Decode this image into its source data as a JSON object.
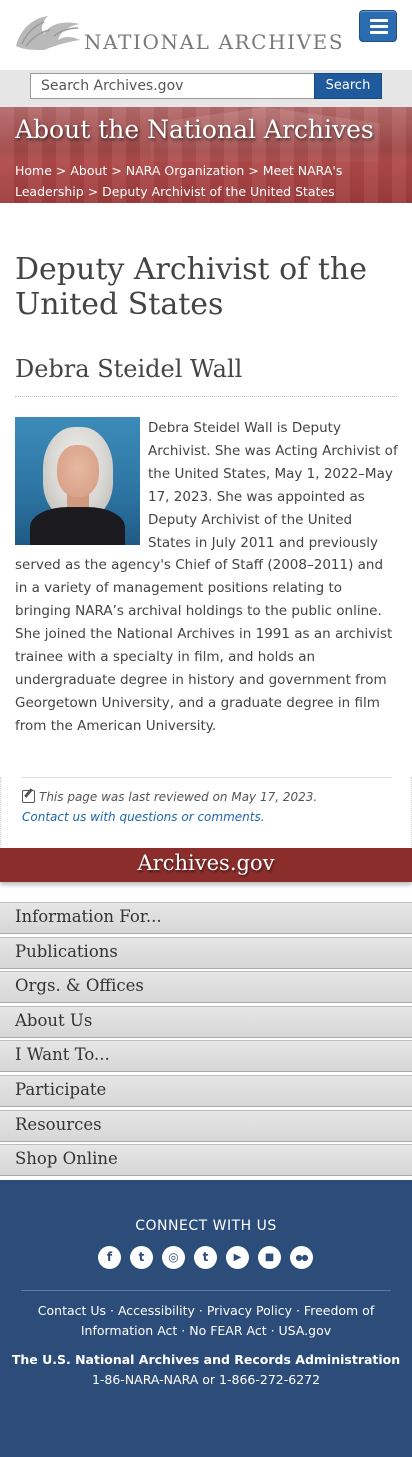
{
  "header": {
    "logo_text": "NATIONAL ARCHIVES",
    "logo_icon": "eagle-logo-icon",
    "menu_icon": "hamburger-menu-icon"
  },
  "search": {
    "placeholder": "Search Archives.gov",
    "button_label": "Search"
  },
  "banner": {
    "title": "About the National Archives",
    "breadcrumb": [
      {
        "label": "Home"
      },
      {
        "label": "About"
      },
      {
        "label": "NARA Organization"
      },
      {
        "label": "Meet NARA's Leadership"
      },
      {
        "label": "Deputy Archivist of the United States"
      }
    ],
    "separator": ">"
  },
  "main": {
    "page_title": "Deputy Archivist of the United States",
    "person_name": "Debra Steidel Wall",
    "bio": "Debra Steidel Wall is Deputy Archivist. She was Acting Archivist of the United States, May 1, 2022–May 17, 2023. She was appointed as Deputy Archivist of the United States in July 2011 and previously served as the agency's Chief of Staff (2008–2011) and in a variety of management positions relating to bringing NARA’s archival holdings to the public online. She joined the National Archives in 1991 as an archivist trainee with a specialty in film, and holds an undergraduate degree in history and government from Georgetown University, and a graduate degree in film from the American University."
  },
  "review": {
    "reviewed_text": "This page was last reviewed on May 17, 2023.",
    "contact_link": "Contact us with questions or comments."
  },
  "site_bar": {
    "title": "Archives.gov"
  },
  "nav": {
    "items": [
      {
        "label": "Information For..."
      },
      {
        "label": "Publications"
      },
      {
        "label": "Orgs. & Offices"
      },
      {
        "label": "About Us"
      },
      {
        "label": "I Want To..."
      },
      {
        "label": "Participate"
      },
      {
        "label": "Resources"
      },
      {
        "label": "Shop Online"
      }
    ]
  },
  "footer": {
    "connect_title": "CONNECT WITH US",
    "social": [
      {
        "name": "facebook-icon",
        "glyph": "f"
      },
      {
        "name": "twitter-icon",
        "glyph": "t"
      },
      {
        "name": "instagram-icon",
        "glyph": "◎"
      },
      {
        "name": "tumblr-icon",
        "glyph": "t"
      },
      {
        "name": "youtube-icon",
        "glyph": "▶"
      },
      {
        "name": "blog-icon",
        "glyph": "■"
      },
      {
        "name": "flickr-icon",
        "glyph": "●●"
      }
    ],
    "links": [
      {
        "label": "Contact Us"
      },
      {
        "label": "Accessibility"
      },
      {
        "label": "Privacy Policy"
      },
      {
        "label": "Freedom of Information Act"
      },
      {
        "label": "No FEAR Act"
      },
      {
        "label": "USA.gov"
      }
    ],
    "link_separator": " · ",
    "org_name": "The U.S. National Archives and Records Administration",
    "phone": "1-86-NARA-NARA or 1-866-272-6272"
  },
  "colors": {
    "banner_red": "#a04848",
    "site_bar_red": "#8b2e2b",
    "footer_blue": "#2c4c7a",
    "link_blue": "#1f66a8",
    "menu_button_blue": "#2b6bb0"
  }
}
